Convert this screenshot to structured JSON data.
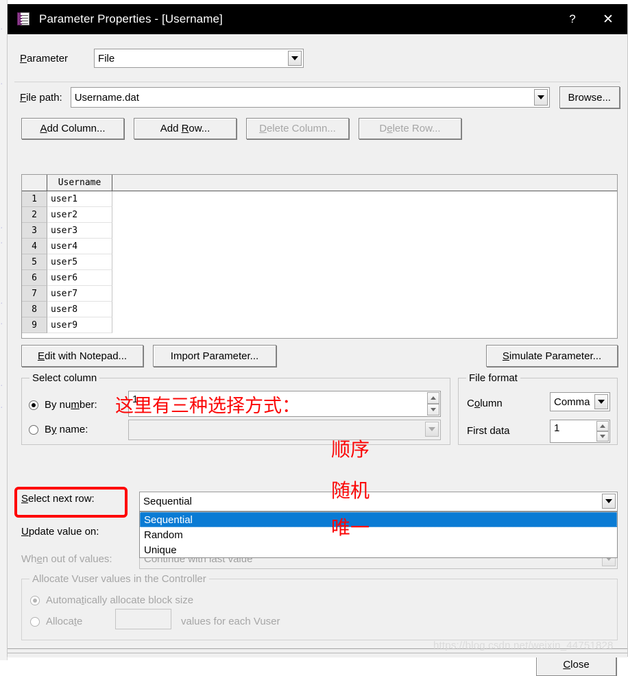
{
  "window": {
    "title": "Parameter Properties - [Username]",
    "icon": "parameter-list-icon",
    "help_label": "?",
    "close_label": "✕"
  },
  "parameter": {
    "label": "Parameter",
    "label_prefix": "P",
    "label_rest": "arameter",
    "value": "File"
  },
  "file_path": {
    "label_prefix": "F",
    "label_rest": "ile path:",
    "value": "Username.dat",
    "browse_label": "Browse..."
  },
  "table_buttons": {
    "add_column": "Add Column...",
    "add_row": "Add Row...",
    "delete_column": "Delete Column...",
    "delete_row": "Delete Row..."
  },
  "grid": {
    "columns": [
      "Username"
    ],
    "rows": [
      {
        "n": "1",
        "cells": [
          "user1"
        ]
      },
      {
        "n": "2",
        "cells": [
          "user2"
        ]
      },
      {
        "n": "3",
        "cells": [
          "user3"
        ]
      },
      {
        "n": "4",
        "cells": [
          "user4"
        ]
      },
      {
        "n": "5",
        "cells": [
          "user5"
        ]
      },
      {
        "n": "6",
        "cells": [
          "user6"
        ]
      },
      {
        "n": "7",
        "cells": [
          "user7"
        ]
      },
      {
        "n": "8",
        "cells": [
          "user8"
        ]
      },
      {
        "n": "9",
        "cells": [
          "user9"
        ]
      }
    ]
  },
  "edit_buttons": {
    "edit_with_notepad": "Edit with Notepad...",
    "import_parameter": "Import Parameter...",
    "simulate_parameter": "Simulate Parameter..."
  },
  "select_column": {
    "legend": "Select column",
    "by_number_label": "By number:",
    "by_number_value": "1",
    "by_name_label": "By name:",
    "by_name_value": "",
    "selected": "by_number"
  },
  "file_format": {
    "legend": "File format",
    "column_label": "Column",
    "column_value": "Comma",
    "first_data_label": "First data",
    "first_data_value": "1"
  },
  "rows_section": {
    "select_next_row_label": "Select next row:",
    "select_next_row_value": "Sequential",
    "select_next_row_options": [
      "Sequential",
      "Random",
      "Unique"
    ],
    "select_next_row_selected_index": 0,
    "update_value_label": "Update value on:",
    "update_value_value": "",
    "when_out_label": "When out of values:",
    "when_out_value": "Continue with last value"
  },
  "allocate": {
    "legend": "Allocate Vuser values in the Controller",
    "auto_label": "Automatically allocate block size",
    "alloc_label": "Allocate",
    "alloc_value": "",
    "alloc_suffix": "values for each Vuser",
    "selected": "auto"
  },
  "footer": {
    "close_label": "Close"
  },
  "annotations": {
    "three_ways": "这里有三种选择方式：",
    "sequential_cn": "顺序",
    "random_cn": "随机",
    "unique_cn": "唯一",
    "highlight_color": "#ff0000"
  },
  "watermark": "https://blog.csdn.net/weixin_44751828"
}
